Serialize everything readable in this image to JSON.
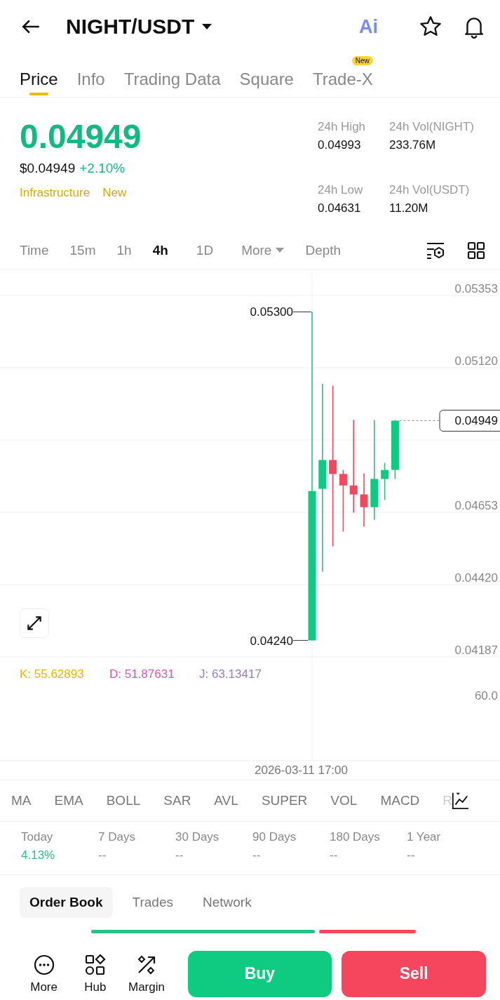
{
  "header": {
    "title": "NIGHT/USDT",
    "ai_label": "Ai"
  },
  "tabs": [
    {
      "label": "Price",
      "selected": true
    },
    {
      "label": "Info",
      "selected": false
    },
    {
      "label": "Trading Data",
      "selected": false
    },
    {
      "label": "Square",
      "selected": false
    },
    {
      "label": "Trade-X",
      "selected": false,
      "badge": "New"
    }
  ],
  "price": {
    "last": "0.04949",
    "usd": "$0.04949",
    "change": "+2.10%",
    "tags": [
      "Infrastructure",
      "New"
    ]
  },
  "stats": [
    {
      "label": "24h High",
      "value": "0.04993"
    },
    {
      "label": "24h Vol(NIGHT)",
      "value": "233.76M"
    },
    {
      "label": "24h Low",
      "value": "0.04631"
    },
    {
      "label": "24h Vol(USDT)",
      "value": "11.20M"
    }
  ],
  "timeframes": [
    {
      "label": "Time",
      "selected": false,
      "kind": "plain"
    },
    {
      "label": "15m",
      "selected": false,
      "kind": "plain"
    },
    {
      "label": "1h",
      "selected": false,
      "kind": "plain"
    },
    {
      "label": "4h",
      "selected": true,
      "kind": "plain"
    },
    {
      "label": "1D",
      "selected": false,
      "kind": "plain"
    },
    {
      "label": "More",
      "selected": false,
      "kind": "dropdown"
    },
    {
      "label": "Depth",
      "selected": false,
      "kind": "plain"
    }
  ],
  "chart": {
    "y_labels": [
      "0.05353",
      "0.05120",
      "0.04653",
      "0.04420",
      "0.04187"
    ],
    "high_marker": "0.05300",
    "low_marker": "0.04240",
    "current_price": "0.04949",
    "kdj": [
      {
        "label": "K: 55.62893",
        "color": "#e6b800"
      },
      {
        "label": "D: 51.87631",
        "color": "#d957b3"
      },
      {
        "label": "J: 63.13417",
        "color": "#9a79c4"
      }
    ],
    "kdj_tick": "60.0",
    "time_label": "2026-03-11 17:00"
  },
  "indicators": [
    "MA",
    "EMA",
    "BOLL",
    "SAR",
    "AVL",
    "SUPER",
    "VOL",
    "MACD",
    "R"
  ],
  "performance": [
    {
      "label": "Today",
      "value": "4.13%",
      "color": "#2ebd85"
    },
    {
      "label": "7 Days",
      "value": "--",
      "color": "#8a8a8a"
    },
    {
      "label": "30 Days",
      "value": "--",
      "color": "#8a8a8a"
    },
    {
      "label": "90 Days",
      "value": "--",
      "color": "#8a8a8a"
    },
    {
      "label": "180 Days",
      "value": "--",
      "color": "#8a8a8a"
    },
    {
      "label": "1 Year",
      "value": "--",
      "color": "#8a8a8a"
    }
  ],
  "book_tabs": [
    {
      "label": "Order Book",
      "selected": true
    },
    {
      "label": "Trades",
      "selected": false
    },
    {
      "label": "Network",
      "selected": false
    }
  ],
  "ratio": {
    "level": 0.69
  },
  "actions": [
    {
      "label": "More",
      "kind": "more"
    },
    {
      "label": "Hub",
      "kind": "hub"
    },
    {
      "label": "Margin",
      "kind": "margin"
    }
  ],
  "trade_buttons": [
    {
      "label": "Buy",
      "kind": "buy"
    },
    {
      "label": "Sell",
      "kind": "sell"
    }
  ]
}
